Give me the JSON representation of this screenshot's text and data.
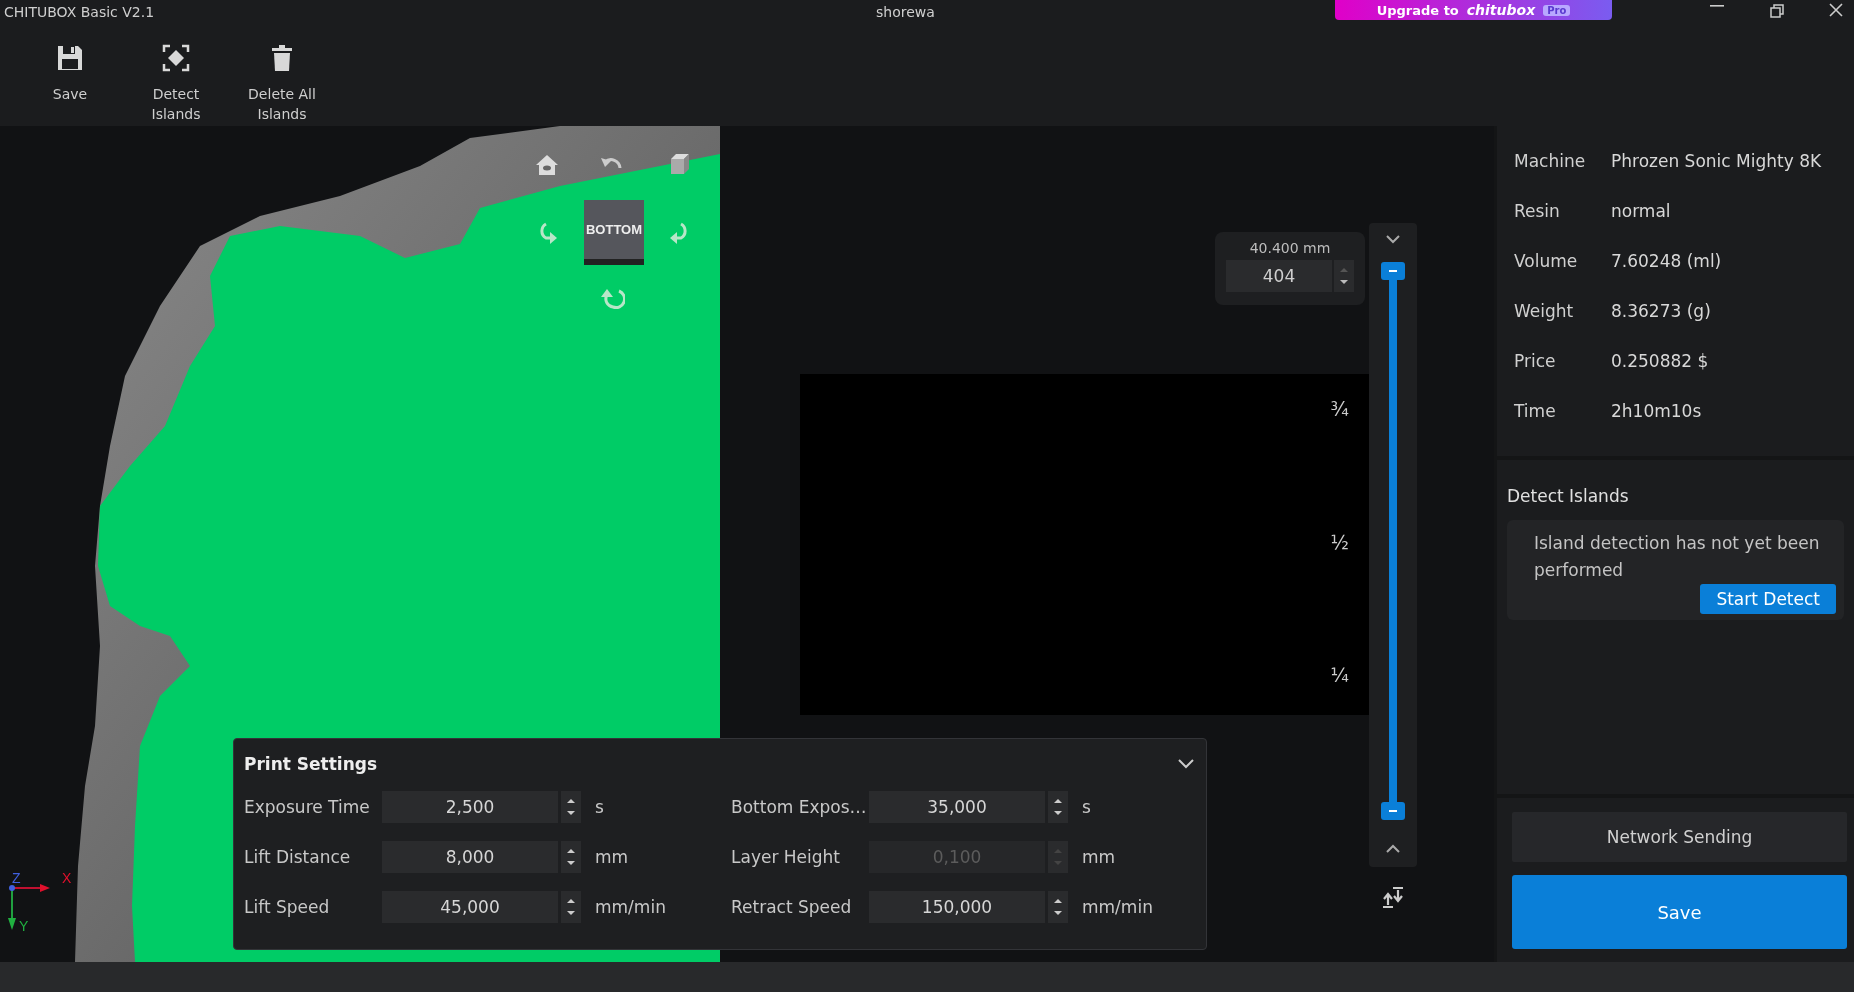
{
  "window": {
    "title": "CHITUBOX Basic V2.1",
    "document": "shorewa"
  },
  "upgrade": {
    "label": "Upgrade to",
    "logo": "chitubox",
    "badge": "Pro"
  },
  "toolbar": [
    {
      "kind": "save",
      "label": "Save"
    },
    {
      "kind": "detect",
      "label": "Detect Islands"
    },
    {
      "kind": "delete",
      "label": "Delete All Islands"
    }
  ],
  "view_cube": {
    "face": "BOTTOM"
  },
  "layer": {
    "height": "40.400 mm",
    "value": "404"
  },
  "preview": {
    "marks": [
      "¾",
      "½",
      "¼"
    ]
  },
  "axes": {
    "x": "X",
    "y": "Y",
    "z": "Z"
  },
  "print_settings": {
    "title": "Print Settings",
    "expanded": true,
    "fields": [
      {
        "label": "Exposure Time",
        "value": "2,500",
        "unit": "s",
        "disabled": false
      },
      {
        "label": "Bottom Expos…",
        "value": "35,000",
        "unit": "s",
        "disabled": false
      },
      {
        "label": "Lift Distance",
        "value": "8,000",
        "unit": "mm",
        "disabled": false
      },
      {
        "label": "Layer Height",
        "value": "0,100",
        "unit": "mm",
        "disabled": true
      },
      {
        "label": "Lift Speed",
        "value": "45,000",
        "unit": "mm/min",
        "disabled": false
      },
      {
        "label": "Retract Speed",
        "value": "150,000",
        "unit": "mm/min",
        "disabled": false
      }
    ]
  },
  "info": [
    {
      "label": "Machine",
      "value": "Phrozen Sonic Mighty 8K"
    },
    {
      "label": "Resin",
      "value": "normal"
    },
    {
      "label": "Volume",
      "value": "7.60248 (ml)"
    },
    {
      "label": "Weight",
      "value": "8.36273 (g)"
    },
    {
      "label": "Price",
      "value": "0.250882 $"
    },
    {
      "label": "Time",
      "value": "2h10m10s"
    }
  ],
  "detect_islands": {
    "title": "Detect Islands",
    "message": "Island detection has not yet been performed",
    "button": "Start Detect"
  },
  "buttons": {
    "network": "Network Sending",
    "save": "Save"
  }
}
